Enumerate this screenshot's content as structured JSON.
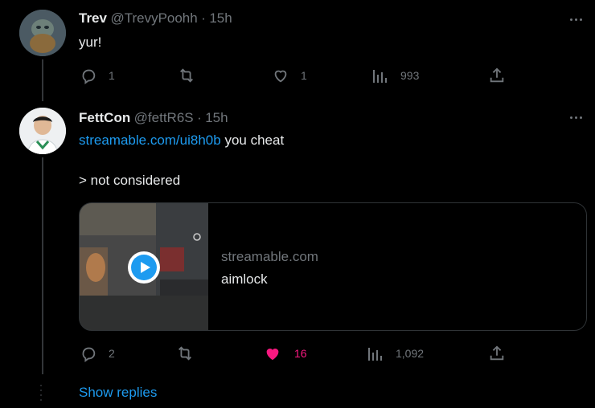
{
  "tweet1": {
    "name": "Trev",
    "handle": "@TrevyPoohh",
    "sep": "·",
    "time": "15h",
    "text": "yur!",
    "replies": "1",
    "retweets": "",
    "likes": "1",
    "views": "993"
  },
  "tweet2": {
    "name": "FettCon",
    "handle": "@fettR6S",
    "sep": "·",
    "time": "15h",
    "link": "streamable.com/ui8h0b",
    "text_after_link": " you cheat",
    "line2": "> not considered",
    "card": {
      "domain": "streamable.com",
      "title": "aimlock"
    },
    "replies": "2",
    "retweets": "",
    "likes": "16",
    "views": "1,092"
  },
  "show_replies": "Show replies",
  "colors": {
    "accent": "#1d9bf0",
    "like": "#f91880",
    "muted": "#71767b",
    "text": "#e7e9ea"
  }
}
